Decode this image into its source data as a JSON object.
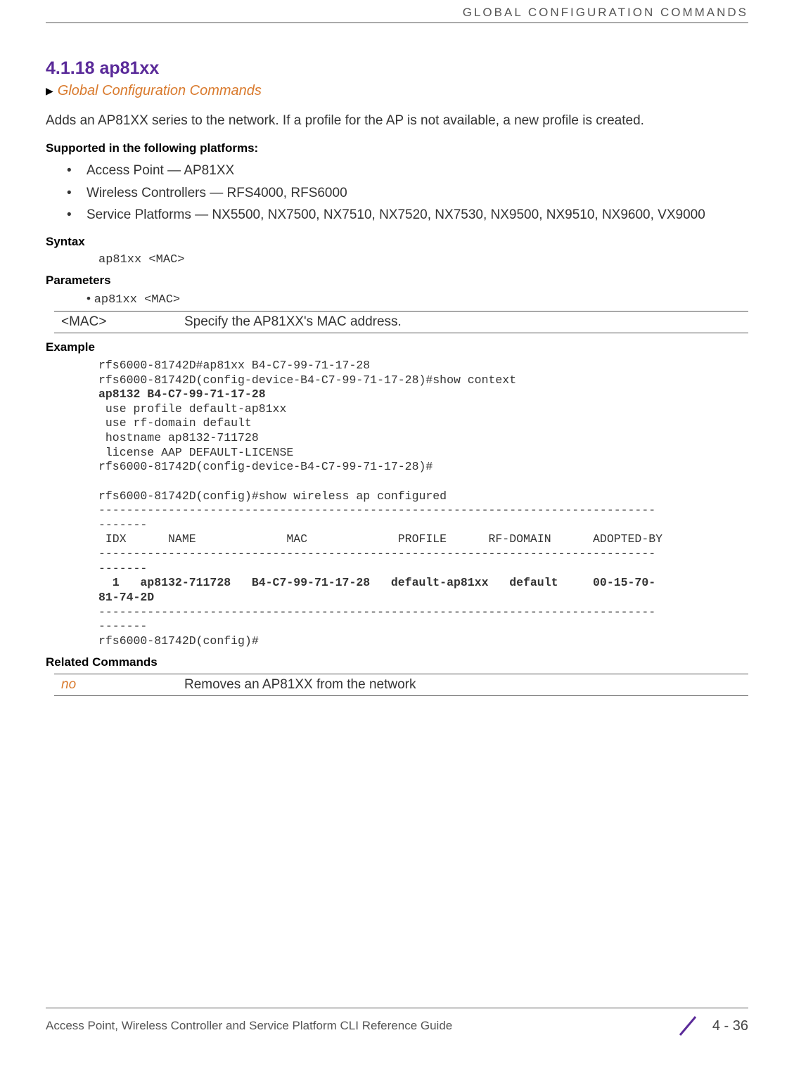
{
  "header": {
    "running_head": "GLOBAL CONFIGURATION COMMANDS"
  },
  "section": {
    "number_title": "4.1.18 ap81xx",
    "breadcrumb": "Global Configuration Commands",
    "intro": "Adds an AP81XX series to the network. If a profile for the AP is not available, a new profile is created."
  },
  "platforms": {
    "heading": "Supported in the following platforms:",
    "items": [
      "Access Point — AP81XX",
      "Wireless Controllers — RFS4000, RFS6000",
      "Service Platforms — NX5500, NX7500, NX7510, NX7520, NX7530, NX9500, NX9510, NX9600, VX9000"
    ]
  },
  "syntax": {
    "heading": "Syntax",
    "line": "ap81xx <MAC>"
  },
  "parameters": {
    "heading": "Parameters",
    "bullet_line": "ap81xx <MAC>",
    "table": {
      "param": "<MAC>",
      "desc": "Specify the AP81XX's MAC address."
    }
  },
  "example": {
    "heading": "Example",
    "lines_plain_1": "rfs6000-81742D#ap81xx B4-C7-99-71-17-28\nrfs6000-81742D(config-device-B4-C7-99-71-17-28)#show context",
    "lines_bold_1": "ap8132 B4-C7-99-71-17-28",
    "lines_plain_2": " use profile default-ap81xx\n use rf-domain default\n hostname ap8132-711728\n license AAP DEFAULT-LICENSE\nrfs6000-81742D(config-device-B4-C7-99-71-17-28)#\n\nrfs6000-81742D(config)#show wireless ap configured\n--------------------------------------------------------------------------------\n-------\n IDX      NAME             MAC             PROFILE      RF-DOMAIN      ADOPTED-BY\n--------------------------------------------------------------------------------\n-------",
    "lines_bold_2": "  1   ap8132-711728   B4-C7-99-71-17-28   default-ap81xx   default     00-15-70-\n81-74-2D",
    "lines_plain_3": "--------------------------------------------------------------------------------\n-------\nrfs6000-81742D(config)#"
  },
  "related": {
    "heading": "Related Commands",
    "cmd": "no",
    "desc": "Removes an AP81XX from the network"
  },
  "footer": {
    "left": "Access Point, Wireless Controller and Service Platform CLI Reference Guide",
    "page": "4 - 36"
  }
}
